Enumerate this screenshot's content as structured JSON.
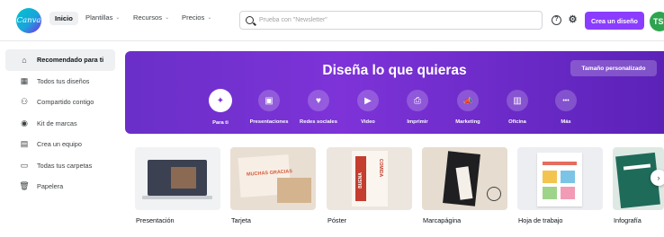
{
  "app": {
    "logo_text": "Canva"
  },
  "nav": {
    "home": "Inicio",
    "items": [
      {
        "label": "Plantillas",
        "chevron": "⌄"
      },
      {
        "label": "Recursos",
        "chevron": "⌄"
      },
      {
        "label": "Precios",
        "chevron": "⌄"
      }
    ]
  },
  "search": {
    "placeholder": "Prueba con \"Newsletter\""
  },
  "header_icons": {
    "help": "?",
    "settings": "⚙"
  },
  "create_button": "Crea un diseño",
  "avatar": {
    "initials": "TS",
    "color": "#2ea44f"
  },
  "sidebar": {
    "items": [
      {
        "label": "Recomendado para ti",
        "icon": "home-icon",
        "glyph": "⌂",
        "active": true
      },
      {
        "label": "Todos tus diseños",
        "icon": "grid-icon",
        "glyph": "▦"
      },
      {
        "label": "Compartido contigo",
        "icon": "people-icon",
        "glyph": "⚇"
      },
      {
        "label": "Kit de marcas",
        "icon": "brand-kit-icon",
        "glyph": "◉"
      },
      {
        "label": "Crea un equipo",
        "icon": "team-icon",
        "glyph": "▤"
      },
      {
        "label": "Todas tus carpetas",
        "icon": "folder-icon",
        "glyph": "▭"
      },
      {
        "label": "Papelera",
        "icon": "trash-icon",
        "glyph": "🗑"
      }
    ]
  },
  "hero": {
    "title": "Diseña lo que quieras",
    "custom_button": "Tamaño personalizado",
    "categories": [
      {
        "label": "Para ti",
        "icon": "sparkle-icon",
        "glyph": "✦",
        "active": true
      },
      {
        "label": "Presentaciones",
        "icon": "presentation-icon",
        "glyph": "▣"
      },
      {
        "label": "Redes sociales",
        "icon": "heart-icon",
        "glyph": "♥"
      },
      {
        "label": "Video",
        "icon": "video-icon",
        "glyph": "▶"
      },
      {
        "label": "Imprimir",
        "icon": "print-icon",
        "glyph": "⎙"
      },
      {
        "label": "Marketing",
        "icon": "megaphone-icon",
        "glyph": "📣"
      },
      {
        "label": "Oficina",
        "icon": "briefcase-icon",
        "glyph": "▥"
      },
      {
        "label": "Más",
        "icon": "more-icon",
        "glyph": "•••"
      }
    ]
  },
  "templates": [
    {
      "label": "Presentación",
      "thumb_color": "#e9eaec"
    },
    {
      "label": "Tarjeta",
      "thumb_color": "#f0e4d6",
      "thumb_text": "MUCHAS GRACIAS"
    },
    {
      "label": "Póster",
      "thumb_color": "#efe6da",
      "thumb_text_a": "BUENA",
      "thumb_text_b": "COMIDA"
    },
    {
      "label": "Marcapágina",
      "thumb_color": "#e7ddd1"
    },
    {
      "label": "Hoja de trabajo",
      "thumb_color": "#eceef2"
    },
    {
      "label": "Infografía",
      "thumb_color": "#dde9e3"
    }
  ],
  "carousel_next": "›"
}
